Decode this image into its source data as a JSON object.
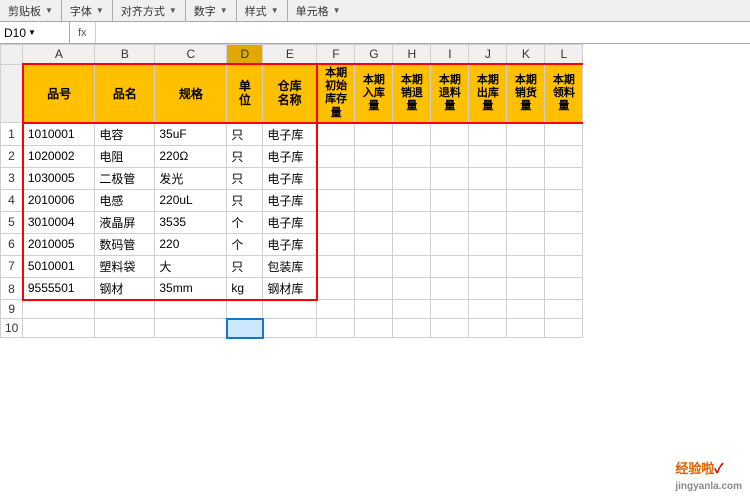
{
  "toolbar": {
    "sections": [
      "剪贴板",
      "字体",
      "对齐方式",
      "数字",
      "样式",
      "单元格"
    ]
  },
  "formula_bar": {
    "cell_ref": "D10",
    "formula_symbol": "fx",
    "formula_value": ""
  },
  "col_headers": [
    "A",
    "B",
    "C",
    "D",
    "E",
    "F",
    "G",
    "H",
    "I",
    "J",
    "K",
    "L"
  ],
  "data_headers": {
    "A": "品号",
    "B": "品名",
    "C": "规格",
    "D": "单\n位",
    "E": "仓库\n名称",
    "F": "本期\n初始\n库存\n量",
    "G": "本期\n入库\n量",
    "H": "本期\n销退\n量",
    "I": "本期\n退料\n量",
    "J": "本期\n出库\n量",
    "K": "本期\n销货\n量",
    "L": "本期\n领料\n量"
  },
  "rows": [
    {
      "num": 1,
      "A": "1010001",
      "B": "电容",
      "C": "35uF",
      "D": "只",
      "E": "电子库"
    },
    {
      "num": 2,
      "A": "1020002",
      "B": "电阻",
      "C": "220Ω",
      "D": "只",
      "E": "电子库"
    },
    {
      "num": 3,
      "A": "1030005",
      "B": "二极管",
      "C": "发光",
      "D": "只",
      "E": "电子库"
    },
    {
      "num": 4,
      "A": "2010006",
      "B": "电感",
      "C": "220uL",
      "D": "只",
      "E": "电子库"
    },
    {
      "num": 5,
      "A": "3010004",
      "B": "液晶屏",
      "C": "3535",
      "D": "个",
      "E": "电子库"
    },
    {
      "num": 6,
      "A": "2010005",
      "B": "数码管",
      "C": "220",
      "D": "个",
      "E": "电子库"
    },
    {
      "num": 7,
      "A": "5010001",
      "B": "塑料袋",
      "C": "大",
      "D": "只",
      "E": "包装库"
    },
    {
      "num": 8,
      "A": "9555501",
      "B": "钢材",
      "C": "35mm",
      "D": "kg",
      "E": "钢材库"
    },
    {
      "num": 9,
      "A": "",
      "B": "",
      "C": "",
      "D": "",
      "E": ""
    },
    {
      "num": 10,
      "A": "",
      "B": "",
      "C": "",
      "D": "",
      "E": ""
    }
  ],
  "watermark": "经验啦✓",
  "watermark_site": "jingyanla.com"
}
